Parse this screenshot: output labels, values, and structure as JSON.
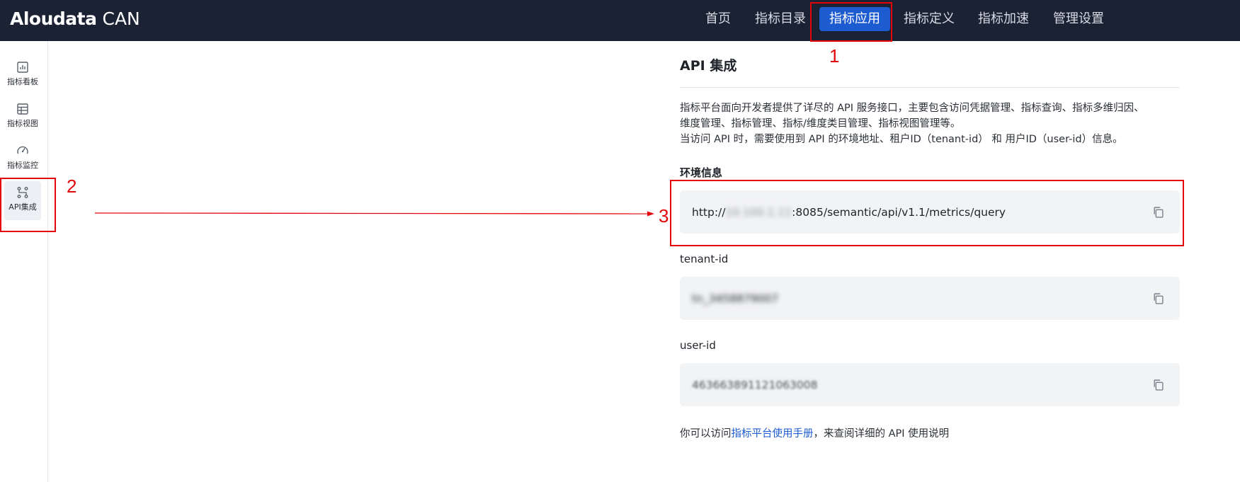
{
  "brand": {
    "name": "Aloudata",
    "product": "CAN"
  },
  "topnav": {
    "items": [
      {
        "label": "首页",
        "active": false
      },
      {
        "label": "指标目录",
        "active": false
      },
      {
        "label": "指标应用",
        "active": true
      },
      {
        "label": "指标定义",
        "active": false
      },
      {
        "label": "指标加速",
        "active": false
      },
      {
        "label": "管理设置",
        "active": false
      }
    ]
  },
  "sidebar": {
    "items": [
      {
        "label": "指标看板",
        "icon": "chart-board-icon",
        "active": false
      },
      {
        "label": "指标视图",
        "icon": "table-view-icon",
        "active": false
      },
      {
        "label": "指标监控",
        "icon": "gauge-icon",
        "active": false
      },
      {
        "label": "API集成",
        "icon": "api-flow-icon",
        "active": true
      }
    ]
  },
  "page": {
    "title": "API 集成",
    "description": [
      "指标平台面向开发者提供了详尽的 API 服务接口，主要包含访问凭据管理、指标查询、指标多维归因、",
      "维度管理、指标管理、指标/维度类目管理、指标视图管理等。",
      "当访问 API 时，需要使用到 API 的环境地址、租户ID（tenant-id） 和 用户ID（user-id）信息。"
    ],
    "env": {
      "label": "环境信息",
      "url_prefix": "http://",
      "url_host_masked": "10.100.1.11",
      "url_suffix": ":8085/semantic/api/v1.1/metrics/query"
    },
    "tenant": {
      "label": "tenant-id",
      "value_masked": "tn_3458879007"
    },
    "user": {
      "label": "user-id",
      "value_masked": "463663891121063008"
    },
    "footer": {
      "prefix": "你可以访问",
      "link": "指标平台使用手册",
      "suffix": "，来查阅详细的 API 使用说明"
    }
  },
  "annotations": {
    "one": "1",
    "two": "2",
    "three": "3",
    "color": "#e3060b"
  },
  "colors": {
    "topbar": "#1a2233",
    "accent": "#1c5bd0",
    "field_bg": "#f2f3f5"
  }
}
